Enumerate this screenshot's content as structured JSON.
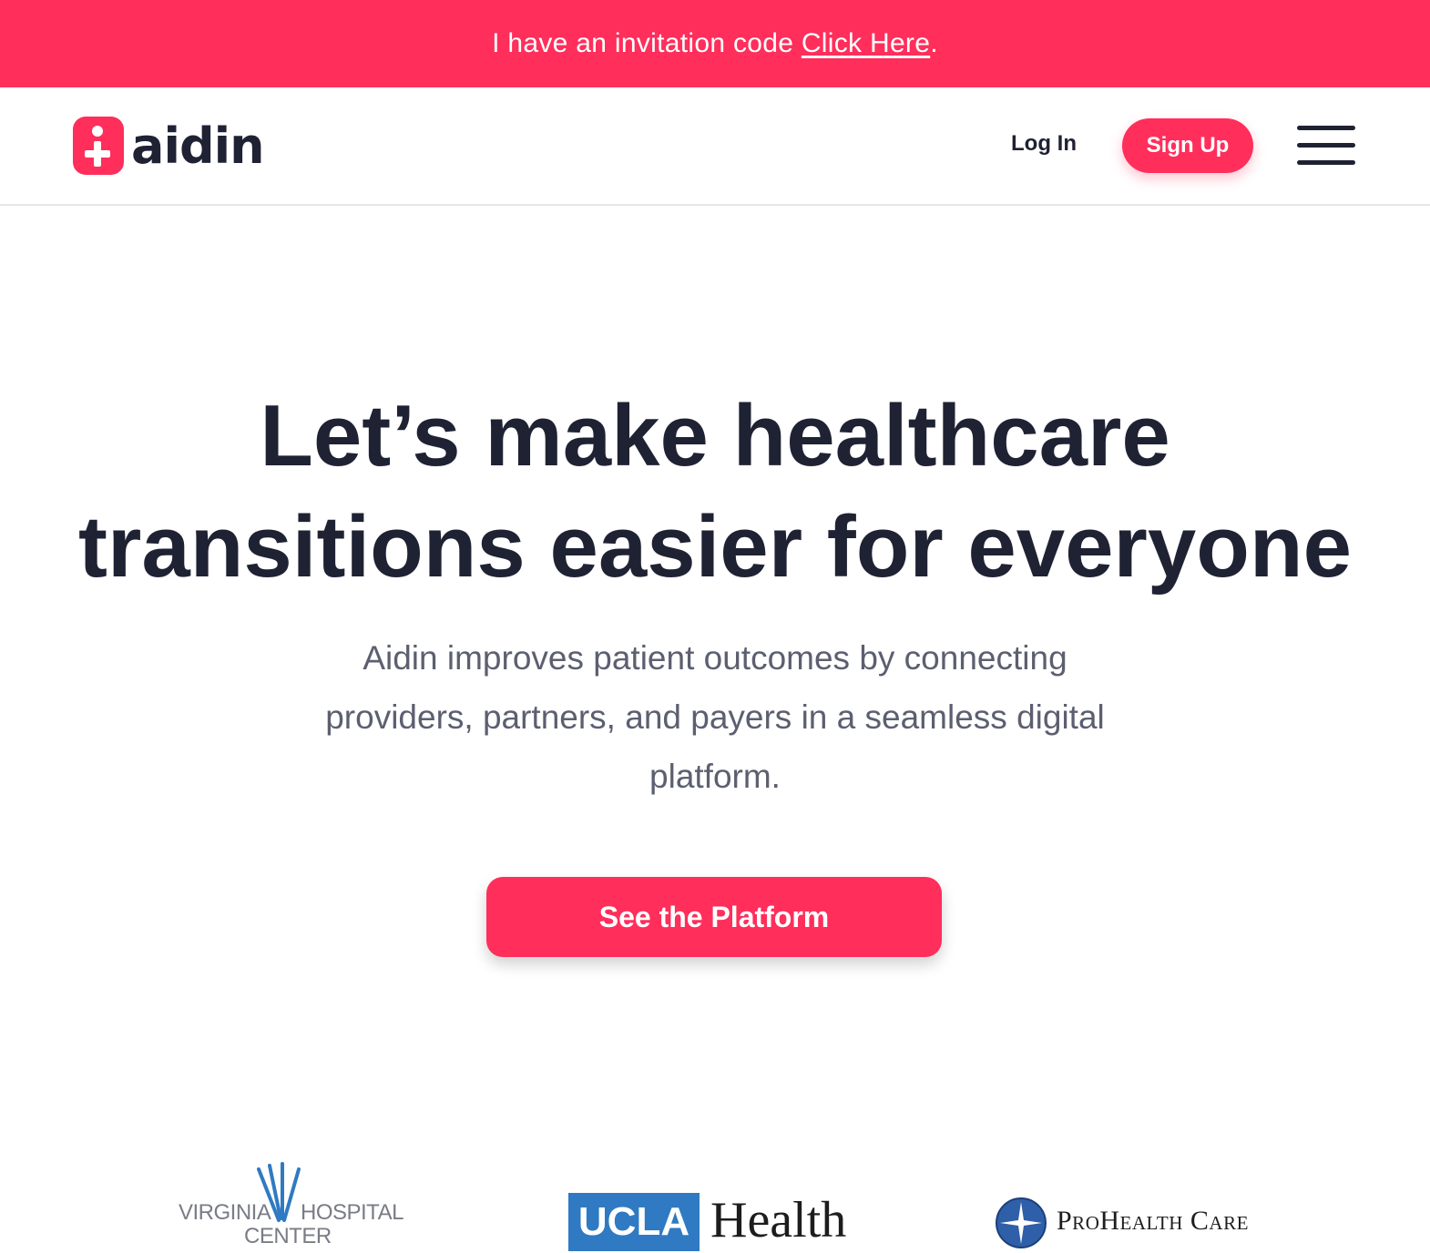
{
  "promo": {
    "text": "I have an invitation code",
    "link_label": "Click Here",
    "suffix": "."
  },
  "nav": {
    "brand": "aidin",
    "login_label": "Log In",
    "signup_label": "Sign Up",
    "menu_icon": "hamburger-menu-icon"
  },
  "hero": {
    "title_line1": "Let’s make healthcare",
    "title_line2": "transitions easier for everyone",
    "subtitle": "Aidin improves patient outcomes by connecting providers, partners, and payers in a seamless digital platform.",
    "cta_label": "See the Platform"
  },
  "partners": {
    "vhc": {
      "line1_left": "VIRGINIA",
      "line1_right": "HOSPITAL",
      "line2": "CENTER"
    },
    "ucla": {
      "box": "UCLA",
      "word": "Health"
    },
    "prohealth": {
      "name": "ProHealth Care"
    }
  },
  "colors": {
    "brand": "#ff2e5b",
    "text_dark": "#1f2233",
    "text_muted": "#5c5f70",
    "ucla_blue": "#2f7ac2"
  }
}
